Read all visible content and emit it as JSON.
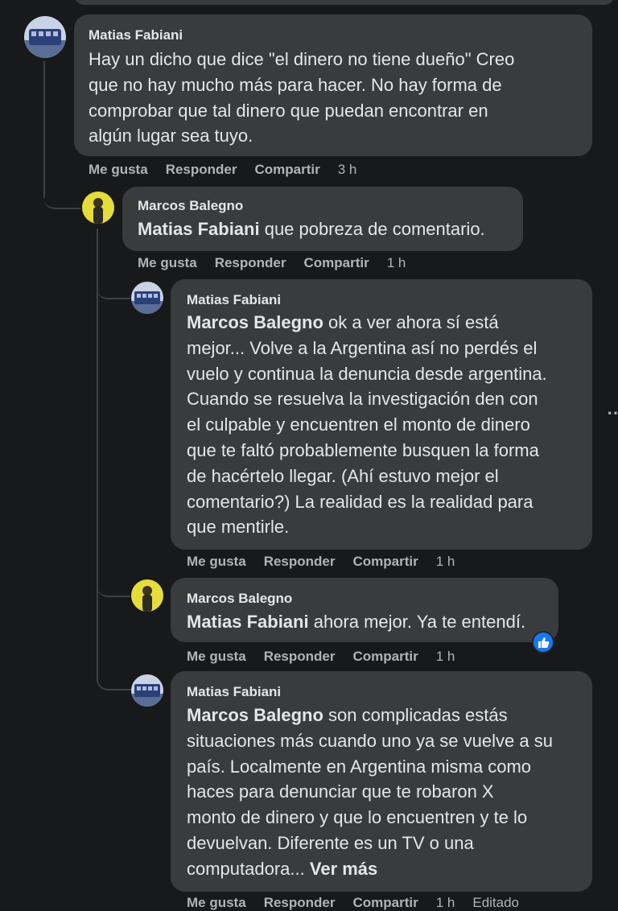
{
  "comments": [
    {
      "author": "Matias Fabiani",
      "text_lines": [
        "Hay un dicho que dice \"el dinero no tiene dueño\" Creo",
        "que no hay mucho más para hacer. No hay forma de",
        "comprobar que tal dinero que puedan encontrar en",
        "algún lugar sea tuyo."
      ],
      "actions": {
        "like": "Me gusta",
        "reply": "Responder",
        "share": "Compartir",
        "time": "3 h"
      }
    }
  ],
  "replies": [
    {
      "author": "Marcos Balegno",
      "mention": "Matias Fabiani",
      "text": " que pobreza de comentario.",
      "actions": {
        "like": "Me gusta",
        "reply": "Responder",
        "share": "Compartir",
        "time": "1 h"
      }
    },
    {
      "author": "Matias Fabiani",
      "mention": "Marcos Balegno",
      "first_line": " ok a ver ahora sí está",
      "text_lines": [
        "mejor... Volve a la Argentina así no perdés el",
        "vuelo y continua la denuncia desde argentina.",
        "Cuando se resuelva la investigación den con",
        "el culpable y encuentren el monto de dinero",
        "que te faltó probablemente busquen la forma",
        "de hacértelo llegar. (Ahí estuvo mejor el",
        "comentario?) La realidad es la realidad para",
        "que mentirle."
      ],
      "actions": {
        "like": "Me gusta",
        "reply": "Responder",
        "share": "Compartir",
        "time": "1 h"
      }
    },
    {
      "author": "Marcos Balegno",
      "mention": "Matias Fabiani",
      "text": " ahora mejor. Ya te entendí.",
      "reaction": "like",
      "actions": {
        "like": "Me gusta",
        "reply": "Responder",
        "share": "Compartir",
        "time": "1 h"
      }
    },
    {
      "author": "Matias Fabiani",
      "mention": "Marcos Balegno",
      "first_line": " son complicadas estás",
      "text_lines": [
        "situaciones más cuando uno ya se vuelve a su",
        "país. Localmente en Argentina misma como",
        "haces para denunciar que te robaron X",
        "monto de dinero y que lo encuentren y te lo",
        "devuelvan. Diferente es un TV o una"
      ],
      "last_line": "computadora... ",
      "see_more": "Ver más",
      "actions": {
        "like": "Me gusta",
        "reply": "Responder",
        "share": "Compartir",
        "time": "1 h",
        "edited": "Editado"
      }
    }
  ],
  "colors": {
    "background": "#18191a",
    "bubble": "#3a3b3c",
    "text": "#e4e6eb",
    "muted": "#b0b3b8",
    "like_blue": "#1877f2"
  }
}
